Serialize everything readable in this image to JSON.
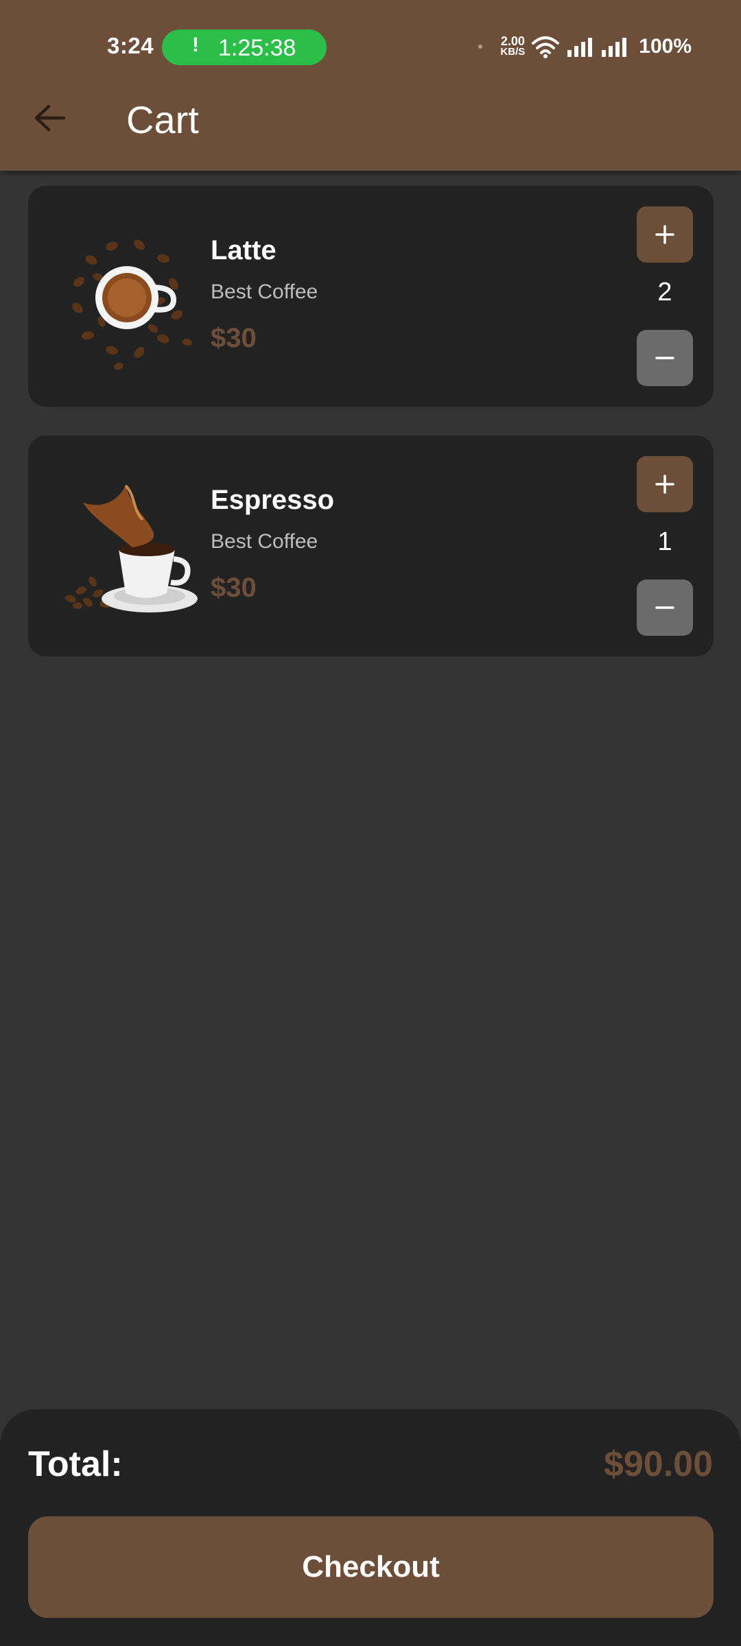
{
  "status_bar": {
    "time": "3:24",
    "call_timer": "1:25:38",
    "call_alert": "!",
    "net_speed_value": "2.00",
    "net_speed_unit": "KB/S",
    "battery": "100%"
  },
  "header": {
    "title": "Cart",
    "back_icon": "arrow-left-icon"
  },
  "cart": {
    "items": [
      {
        "name": "Latte",
        "subtitle": "Best Coffee",
        "price": "$30",
        "quantity": "2",
        "image": "latte-cup-with-beans"
      },
      {
        "name": "Espresso",
        "subtitle": "Best Coffee",
        "price": "$30",
        "quantity": "1",
        "image": "espresso-cup-splash"
      }
    ]
  },
  "summary": {
    "total_label": "Total:",
    "total_value": "$90.00",
    "checkout_label": "Checkout"
  },
  "colors": {
    "brand": "#6d4e38",
    "background": "#333333",
    "card": "#222222",
    "call_green": "#2bbf4a",
    "minus_button": "#6b6b6b"
  }
}
